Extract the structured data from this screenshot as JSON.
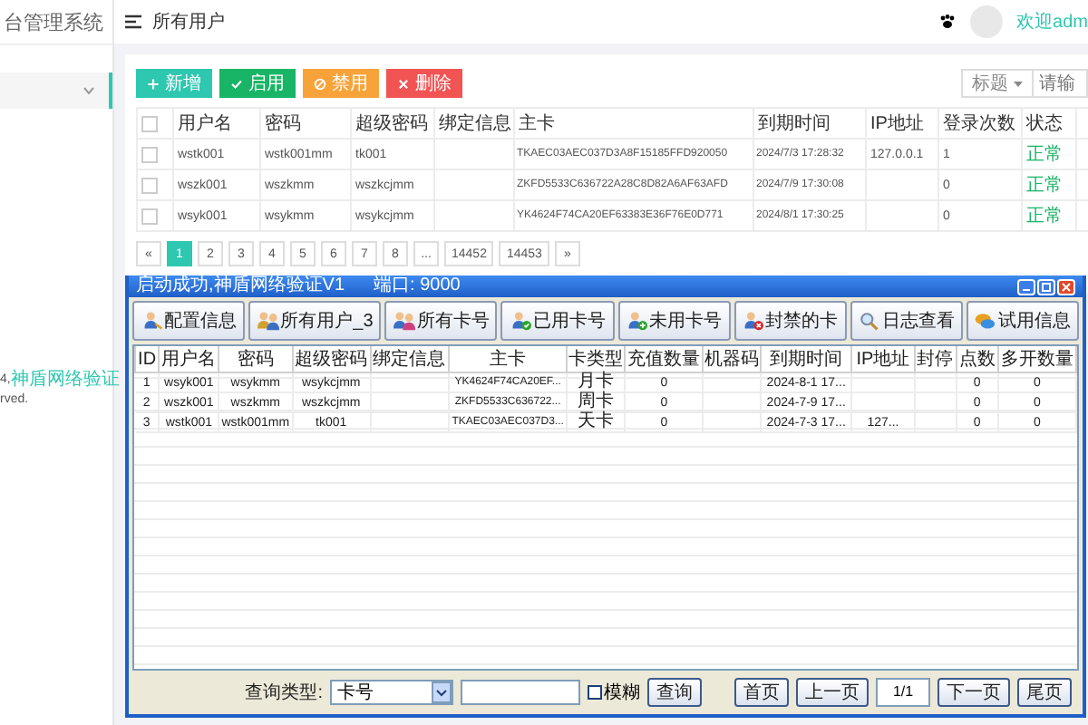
{
  "sidebar": {
    "title": "台管理系统",
    "items": [
      {
        "selected": true
      }
    ],
    "footer_prefix": "4, ",
    "footer_link": "神盾网络验证",
    "footer_tail": "rved."
  },
  "header": {
    "breadcrumb": "所有用户",
    "user": "欢迎adm"
  },
  "actions": [
    {
      "kind": "add",
      "label": "新增"
    },
    {
      "kind": "enable",
      "label": "启用"
    },
    {
      "kind": "disable",
      "label": "禁用"
    },
    {
      "kind": "delete",
      "label": "删除"
    }
  ],
  "filter": {
    "select": "标题",
    "placeholder": "请输"
  },
  "table": {
    "all_checked": false,
    "columns": [
      "用户名",
      "密码",
      "超级密码",
      "绑定信息",
      "主卡",
      "到期时间",
      "IP地址",
      "登录次数",
      "状态"
    ],
    "rows": [
      {
        "checked": false,
        "cells": [
          "wstk001",
          "wstk001mm",
          "tk001",
          "",
          "TKAEC03AEC037D3A8F15185FFD920050",
          "2024/7/3 17:28:32",
          "127.0.0.1",
          "1",
          "正常"
        ]
      },
      {
        "checked": false,
        "cells": [
          "wszk001",
          "wszkmm",
          "wszkcjmm",
          "",
          "ZKFD5533C636722A28C8D82A6AF63AFD",
          "2024/7/9 17:30:08",
          "",
          "0",
          "正常"
        ]
      },
      {
        "checked": false,
        "cells": [
          "wsyk001",
          "wsykmm",
          "wsykcjmm",
          "",
          "YK4624F74CA20EF63383E36F76E0D771",
          "2024/8/1 17:30:25",
          "",
          "0",
          "正常"
        ]
      }
    ]
  },
  "pagination": {
    "prev": "«",
    "next": "»",
    "pages": [
      {
        "label": "1",
        "selected": true
      },
      {
        "label": "2",
        "selected": false
      },
      {
        "label": "3",
        "selected": false
      },
      {
        "label": "4",
        "selected": false
      },
      {
        "label": "5",
        "selected": false
      },
      {
        "label": "6",
        "selected": false
      },
      {
        "label": "7",
        "selected": false
      },
      {
        "label": "8",
        "selected": false
      },
      {
        "label": "...",
        "selected": false
      },
      {
        "label": "14452",
        "selected": false
      },
      {
        "label": "14453",
        "selected": false
      }
    ]
  },
  "dialog": {
    "title": "启动成功,神盾网络验证V1",
    "port": "端口: 9000",
    "toolbar": [
      {
        "kind": "config",
        "label": "配置信息"
      },
      {
        "kind": "users",
        "label": "所有用户_3"
      },
      {
        "kind": "cards",
        "label": "所有卡号"
      },
      {
        "kind": "used",
        "label": "已用卡号"
      },
      {
        "kind": "unused",
        "label": "未用卡号"
      },
      {
        "kind": "banned",
        "label": "封禁的卡"
      },
      {
        "kind": "log",
        "label": "日志查看"
      },
      {
        "kind": "trial",
        "label": "试用信息"
      }
    ],
    "columns": [
      "ID",
      "用户名",
      "密码",
      "超级密码",
      "绑定信息",
      "主卡",
      "卡类型",
      "充值数量",
      "机器码",
      "到期时间",
      "IP地址",
      "封停",
      "点数",
      "多开数量"
    ],
    "rows": [
      [
        "1",
        "wsyk001",
        "wsykmm",
        "wsykcjmm",
        "",
        "YK4624F74CA20EF...",
        "月卡",
        "0",
        "",
        "2024-8-1 17...",
        "",
        "",
        "0",
        "0"
      ],
      [
        "2",
        "wszk001",
        "wszkmm",
        "wszkcjmm",
        "",
        "ZKFD5533C636722...",
        "周卡",
        "0",
        "",
        "2024-7-9 17...",
        "",
        "",
        "0",
        "0"
      ],
      [
        "3",
        "wstk001",
        "wstk001mm",
        "tk001",
        "",
        "TKAEC03AEC037D3...",
        "天卡",
        "0",
        "",
        "2024-7-3 17...",
        "127...",
        "",
        "0",
        "0"
      ]
    ],
    "query_label": "查询类型:",
    "query_select": "卡号",
    "fuzzy": {
      "label": "模糊",
      "checked": false
    },
    "search": "查询",
    "nav": [
      "首页",
      "上一页",
      "1/1",
      "下一页",
      "尾页"
    ]
  }
}
